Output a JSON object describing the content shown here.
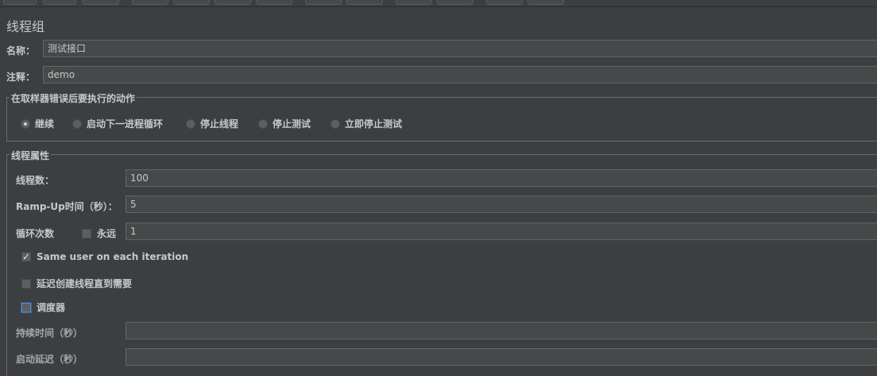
{
  "panel": {
    "title": "线程组"
  },
  "name_row": {
    "label": "名称：",
    "value": "测试接口"
  },
  "comment_row": {
    "label": "注释：",
    "value": "demo"
  },
  "error_action": {
    "title": "在取样器错误后要执行的动作",
    "options": [
      {
        "label": "继续",
        "checked": true
      },
      {
        "label": "启动下一进程循环",
        "checked": false
      },
      {
        "label": "停止线程",
        "checked": false
      },
      {
        "label": "停止测试",
        "checked": false
      },
      {
        "label": "立即停止测试",
        "checked": false
      }
    ]
  },
  "thread_props": {
    "title": "线程属性",
    "num_threads": {
      "label": "线程数：",
      "value": "100"
    },
    "ramp_up": {
      "label": "Ramp-Up时间（秒）：",
      "value": "5"
    },
    "loop_count": {
      "label": "循环次数",
      "forever_label": "永远",
      "forever_checked": false,
      "value": "1"
    },
    "same_user": {
      "label": "Same user on each iteration",
      "checked": true
    },
    "delay_create": {
      "label": "延迟创建线程直到需要",
      "checked": false
    },
    "scheduler": {
      "label": "调度器",
      "checked": false
    },
    "duration": {
      "label": "持续时间（秒）",
      "value": ""
    },
    "startup_delay": {
      "label": "启动延迟（秒）",
      "value": ""
    }
  },
  "colors": {
    "background": "#3c3f41",
    "field_bg": "#45494a",
    "text": "#c8c8c8",
    "focus": "#5b8ac7"
  }
}
